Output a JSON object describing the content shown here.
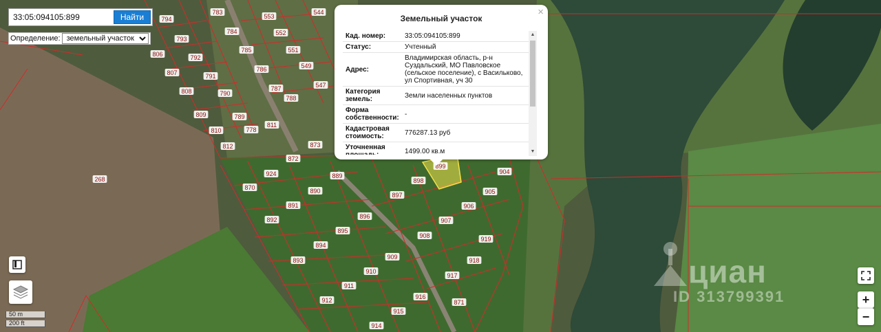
{
  "search": {
    "value": "33:05:094105:899",
    "button_label": "Найти"
  },
  "definition": {
    "label": "Определение:",
    "selected": "земельный участок"
  },
  "popup": {
    "title": "Земельный участок",
    "close_glyph": "×",
    "rows": [
      {
        "key": "Кад. номер:",
        "value": "33:05:094105:899"
      },
      {
        "key": "Статус:",
        "value": "Учтенный"
      },
      {
        "key": "Адрес:",
        "value": "Владимирская область, р-н Суздальский, МО Павловское (сельское поселение), с Васильково, ул Спортивная, уч 30"
      },
      {
        "key": "Категория земель:",
        "value": "Земли населенных пунктов"
      },
      {
        "key": "Форма собственности:",
        "value": "-"
      },
      {
        "key": "Кадастровая стоимость:",
        "value": "776287.13 руб"
      },
      {
        "key": "Уточненная площадь:",
        "value": "1499.00 кв.м"
      }
    ]
  },
  "plot_labels": [
    "794",
    "783",
    "553",
    "544",
    "793",
    "784",
    "552",
    "806",
    "792",
    "785",
    "551",
    "807",
    "791",
    "786",
    "549",
    "808",
    "790",
    "787",
    "547",
    "809",
    "789",
    "788",
    "810",
    "778",
    "811",
    "812",
    "873",
    "872",
    "924",
    "889",
    "870",
    "890",
    "898",
    "897",
    "891",
    "896",
    "906",
    "892",
    "895",
    "907",
    "894",
    "908",
    "919",
    "893",
    "909",
    "918",
    "910",
    "917",
    "911",
    "916",
    "912",
    "915",
    "871",
    "914",
    "268",
    "899",
    "904",
    "905"
  ],
  "scale": {
    "metric": "50 m",
    "imperial": "200 ft"
  },
  "controls": {
    "zoom_in": "+",
    "zoom_out": "−"
  },
  "watermark": {
    "brand": "циан",
    "id": "ID 313799391"
  },
  "colors": {
    "boundary": "#d42a2a",
    "selected_fill": "#f2e14a",
    "button": "#1a7fd4"
  }
}
